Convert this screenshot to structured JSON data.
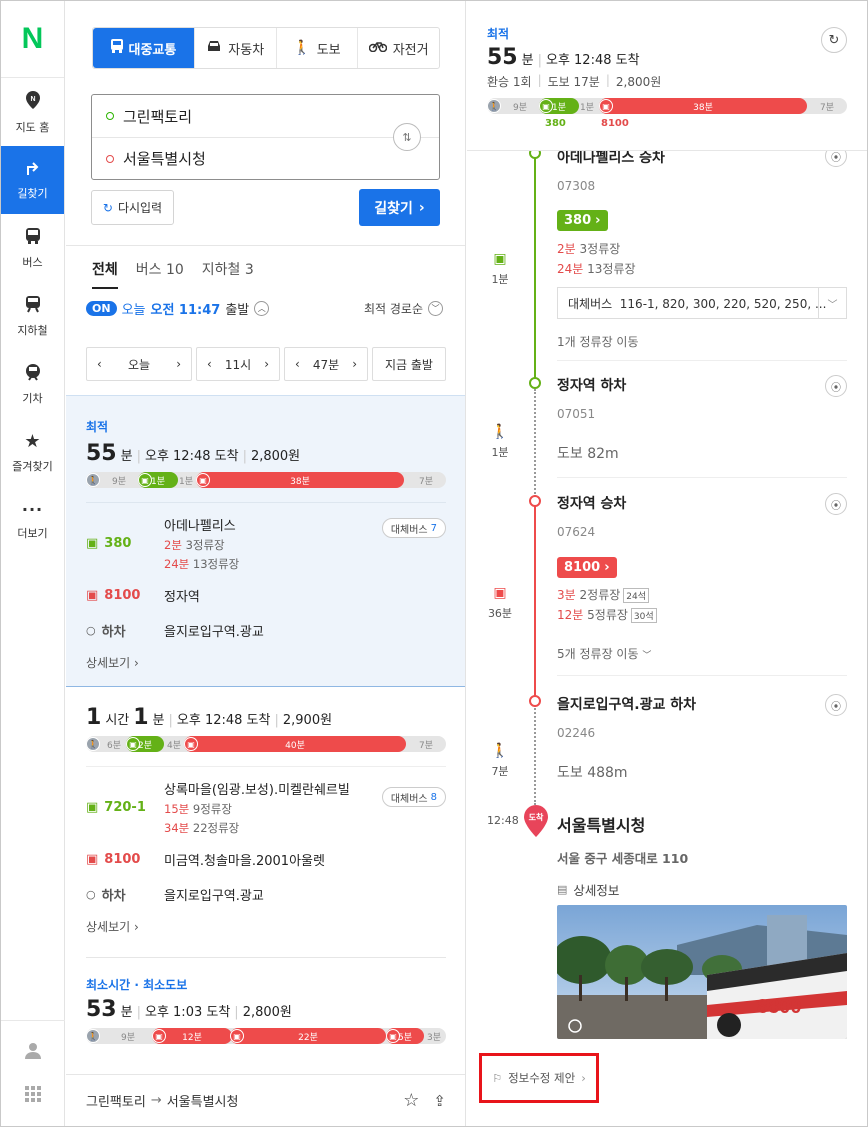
{
  "nav": {
    "logo": "N",
    "items": [
      {
        "label": "지도 홈",
        "icon": "map-pin-icon"
      },
      {
        "label": "길찾기",
        "icon": "directions-icon"
      },
      {
        "label": "버스",
        "icon": "bus-icon"
      },
      {
        "label": "지하철",
        "icon": "subway-icon"
      },
      {
        "label": "기차",
        "icon": "train-icon"
      },
      {
        "label": "즐겨찾기",
        "icon": "star-icon"
      },
      {
        "label": "더보기",
        "icon": "more-icon"
      }
    ]
  },
  "modes": [
    "대중교통",
    "자동차",
    "도보",
    "자전거"
  ],
  "route": {
    "from": "그린팩토리",
    "to": "서울특별시청"
  },
  "buttons": {
    "reset": "다시입력",
    "search": "길찾기"
  },
  "tabs": [
    "전체",
    "버스 10",
    "지하철 3"
  ],
  "depart": {
    "badge": "ON",
    "day": "오늘",
    "time": "오전 11:47",
    "suffix": "출발",
    "sort": "최적 경로순"
  },
  "timectl": {
    "day": "오늘",
    "hour": "11시",
    "minute": "47분",
    "now": "지금 출발"
  },
  "results": [
    {
      "tag": "최적",
      "dur_main": "55",
      "dur_unit": "분",
      "arrive": "오후 12:48 도착",
      "fare": "2,800원",
      "timeline": [
        "9분",
        "1분",
        "1분",
        "38분",
        "7분"
      ],
      "legs": [
        {
          "no": "380",
          "stop": "아데나펠리스",
          "alt": "대체버스",
          "alt_n": "7",
          "l1a": "2분",
          "l1b": "3정류장",
          "l2a": "24분",
          "l2b": "13정류장"
        },
        {
          "no": "8100",
          "stop": "정자역"
        },
        {
          "no": "하차",
          "stop": "을지로입구역.광교"
        }
      ],
      "more": "상세보기"
    },
    {
      "dur_h": "1",
      "dur_h_unit": "시간",
      "dur_m": "1",
      "dur_m_unit": "분",
      "arrive": "오후 12:48 도착",
      "fare": "2,900원",
      "timeline": [
        "6분",
        "2분",
        "4분",
        "40분",
        "7분"
      ],
      "legs": [
        {
          "no": "720-1",
          "stop": "상록마을(임광.보성).미켈란쉐르빌",
          "alt": "대체버스",
          "alt_n": "8",
          "l1a": "15분",
          "l1b": "9정류장",
          "l2a": "34분",
          "l2b": "22정류장"
        },
        {
          "no": "8100",
          "stop": "미금역.청솔마을.2001아울렛"
        },
        {
          "no": "하차",
          "stop": "을지로입구역.광교"
        }
      ],
      "more": "상세보기"
    },
    {
      "tag": "최소시간 · 최소도보",
      "dur_main": "53",
      "dur_unit": "분",
      "arrive": "오후 1:03 도착",
      "fare": "2,800원",
      "timeline": [
        "9분",
        "12분",
        "22분",
        "5분",
        "3분"
      ]
    }
  ],
  "footer": {
    "from": "그린팩토리",
    "arrow": "→",
    "to": "서울특별시청"
  },
  "detail": {
    "tag": "최적",
    "dur": "55",
    "dur_unit": "분",
    "arrive": "오후 12:48 도착",
    "transfer": "환승 1회",
    "walk": "도보 17분",
    "fare": "2,800원",
    "timeline": [
      "9분",
      "1분",
      "1분",
      "38분",
      "7분"
    ],
    "under": {
      "bus1": "380",
      "bus2": "8100"
    },
    "steps": {
      "s1": {
        "name": "아데나펠리스 승차",
        "id": "07308"
      },
      "bus1": {
        "no": "380",
        "l1a": "2분",
        "l1b": "3정류장",
        "l2a": "24분",
        "l2b": "13정류장",
        "alt": "대체버스  116-1, 820, 300, 220, 520, 250, ...",
        "move": "1개 정류장 이동",
        "side": "1분"
      },
      "s2": {
        "name": "정자역 하차",
        "id": "07051"
      },
      "walk1": {
        "text": "도보 82m",
        "side": "1분"
      },
      "s3": {
        "name": "정자역 승차",
        "id": "07624"
      },
      "bus2": {
        "no": "8100",
        "l1a": "3분",
        "l1b": "2정류장",
        "seat1": "24석",
        "l2a": "12분",
        "l2b": "5정류장",
        "seat2": "30석",
        "move": "5개 정류장 이동",
        "side": "36분"
      },
      "s4": {
        "name": "을지로입구역.광교 하차",
        "id": "02246"
      },
      "walk2": {
        "text": "도보 488m",
        "side": "7분"
      },
      "dest": {
        "time": "12:48",
        "badge": "도착",
        "name": "서울특별시청",
        "addr": "서울 중구 세종대로 110",
        "info": "상세정보"
      }
    },
    "photo_bus": "8800",
    "suggest": "정보수정 제안"
  },
  "colors": {
    "blue": "#1a73e8",
    "green": "#64b117",
    "red": "#ee4b4b",
    "naver": "#03c75a"
  }
}
